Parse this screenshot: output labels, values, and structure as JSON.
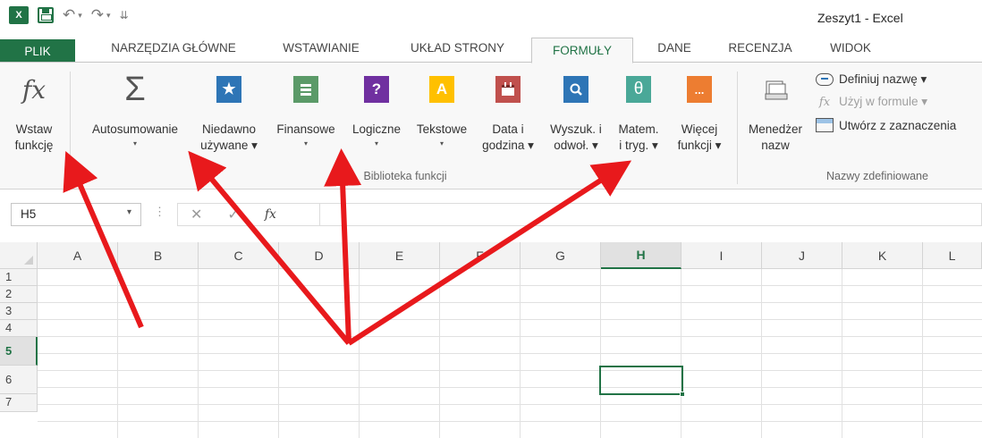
{
  "window": {
    "title": "Zeszyt1 - Excel"
  },
  "qat": {
    "undo": "↶",
    "redo": "↷",
    "customize": "⇊"
  },
  "tabs": [
    {
      "label": "PLIK"
    },
    {
      "label": "NARZĘDZIA GŁÓWNE"
    },
    {
      "label": "WSTAWIANIE"
    },
    {
      "label": "UKŁAD STRONY"
    },
    {
      "label": "FORMUŁY"
    },
    {
      "label": "DANE"
    },
    {
      "label": "RECENZJA"
    },
    {
      "label": "WIDOK"
    }
  ],
  "ribbon": {
    "groups": {
      "library": "Biblioteka funkcji",
      "names": "Nazwy zdefiniowane"
    },
    "buttons": {
      "insert_function": {
        "line1": "Wstaw",
        "line2": "funkcję"
      },
      "autosum": {
        "line1": "Autosumowanie",
        "caret": "▾"
      },
      "recent": {
        "line1": "Niedawno",
        "line2": "używane ▾"
      },
      "financial": {
        "line1": "Finansowe",
        "caret": "▾"
      },
      "logical": {
        "line1": "Logiczne",
        "caret": "▾"
      },
      "text": {
        "line1": "Tekstowe",
        "caret": "▾"
      },
      "datetime": {
        "line1": "Data i",
        "line2": "godzina ▾"
      },
      "lookup": {
        "line1": "Wyszuk. i",
        "line2": "odwoł. ▾"
      },
      "math": {
        "line1": "Matem.",
        "line2": "i tryg. ▾"
      },
      "more": {
        "line1": "Więcej",
        "line2": "funkcji ▾"
      },
      "name_manager": {
        "line1": "Menedżer",
        "line2": "nazw"
      }
    },
    "small_buttons": {
      "define_name": "Definiuj nazwę ▾",
      "use_in_formula": "Użyj w formule ▾",
      "create_from_selection": "Utwórz z zaznaczenia"
    },
    "icon_glyphs": {
      "fx": "fx",
      "sigma": "Σ",
      "star": "★",
      "question": "?",
      "letter_a": "A",
      "theta": "θ",
      "ellipsis": "...",
      "magnifier": "⚲"
    },
    "colors": {
      "recent": "#2e75b6",
      "financial": "#5b9a68",
      "logical": "#7030a0",
      "text": "#ffc000",
      "datetime": "#c0504d",
      "lookup": "#2e75b6",
      "math": "#4aa898",
      "more": "#ed7d31"
    }
  },
  "formula_bar": {
    "name_box": "H5",
    "name_box_caret": "▾",
    "separator": "⋮",
    "cancel": "✕",
    "enter": "✓",
    "fx": "fx",
    "value": ""
  },
  "sheet": {
    "columns": [
      "A",
      "B",
      "C",
      "D",
      "E",
      "F",
      "G",
      "H",
      "I",
      "J",
      "K",
      "L"
    ],
    "rows": [
      "1",
      "2",
      "3",
      "4",
      "5",
      "6",
      "7"
    ],
    "active_cell": "H5"
  },
  "accent_color": "#217346",
  "annotation_color": "#e8191c"
}
